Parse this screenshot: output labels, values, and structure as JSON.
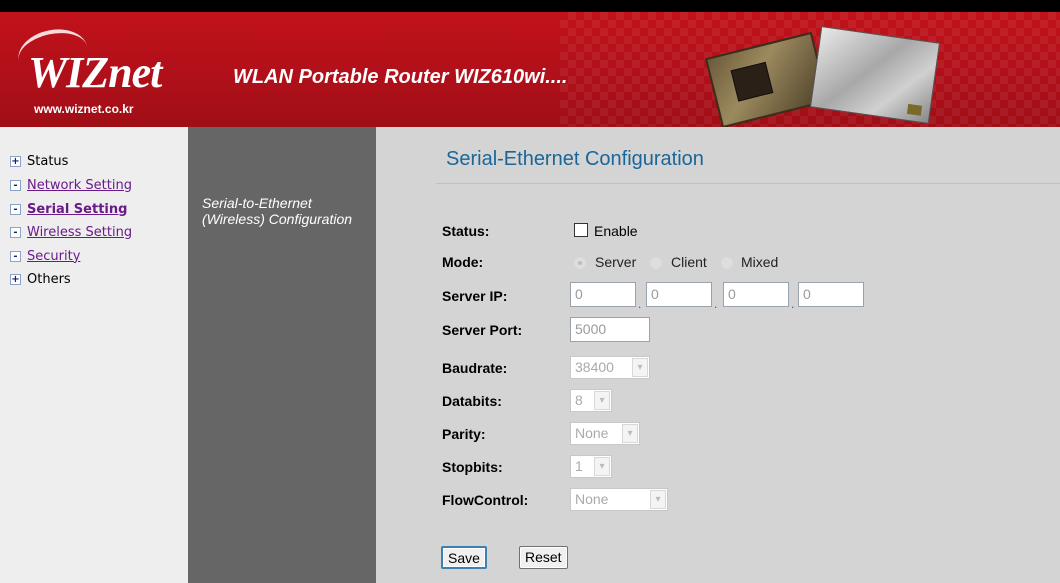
{
  "header": {
    "logo": "WIZnet",
    "logo_url": "www.wiznet.co.kr",
    "title": "WLAN Portable Router WIZ610wi...."
  },
  "sidebar": {
    "items": [
      {
        "label": "Status",
        "toggle": "+"
      },
      {
        "label": "Network Setting",
        "toggle": "-"
      },
      {
        "label": "Serial Setting",
        "toggle": "-"
      },
      {
        "label": "Wireless Setting",
        "toggle": "-"
      },
      {
        "label": "Security",
        "toggle": "-"
      },
      {
        "label": "Others",
        "toggle": "+"
      }
    ]
  },
  "midcol": {
    "text": "Serial-to-Ethernet (Wireless) Configuration"
  },
  "main": {
    "title": "Serial-Ethernet Configuration",
    "status_label": "Status:",
    "enable_label": "Enable",
    "mode_label": "Mode:",
    "mode_options": [
      "Server",
      "Client",
      "Mixed"
    ],
    "server_ip_label": "Server IP:",
    "server_ip": [
      "0",
      "0",
      "0",
      "0"
    ],
    "server_port_label": "Server Port:",
    "server_port": "5000",
    "baudrate_label": "Baudrate:",
    "baudrate": "38400",
    "databits_label": "Databits:",
    "databits": "8",
    "parity_label": "Parity:",
    "parity": "None",
    "stopbits_label": "Stopbits:",
    "stopbits": "1",
    "flowcontrol_label": "FlowControl:",
    "flowcontrol": "None",
    "save_label": "Save",
    "reset_label": "Reset"
  },
  "colors": {
    "header_red": "#b0101a",
    "title_blue": "#1b6699",
    "nav_link": "#6b1a8a",
    "midcol_gray": "#666666",
    "main_bg": "#d4d4d4"
  }
}
